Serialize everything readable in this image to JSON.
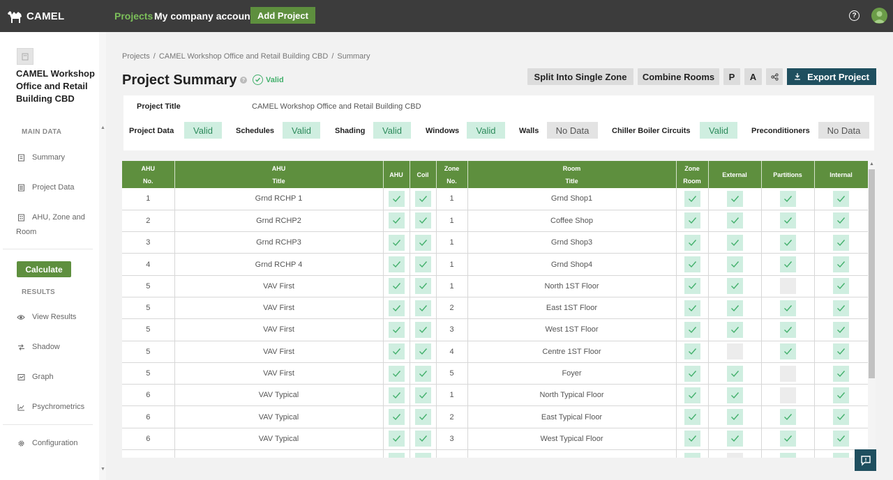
{
  "app": {
    "logo": "CAMEL"
  },
  "topnav": {
    "projects": "Projects",
    "company": "My company accounts",
    "add_project": "Add Project"
  },
  "sidebar": {
    "project_name": "CAMEL Workshop Office and Retail Building CBD",
    "main_data_label": "MAIN DATA",
    "items": [
      {
        "label": "Summary",
        "icon": "document-icon"
      },
      {
        "label": "Project Data",
        "icon": "list-icon"
      },
      {
        "label": "AHU, Zone and Room",
        "icon": "building-icon"
      }
    ],
    "calculate": "Calculate",
    "results_label": "RESULTS",
    "result_items": [
      {
        "label": "View Results",
        "icon": "eye-icon"
      },
      {
        "label": "Shadow",
        "icon": "shadow-icon"
      },
      {
        "label": "Graph",
        "icon": "graph-icon"
      },
      {
        "label": "Psychrometrics",
        "icon": "chart-icon"
      }
    ],
    "configuration": "Configuration"
  },
  "breadcrumb": [
    "Projects",
    "CAMEL Workshop Office and Retail Building CBD",
    "Summary"
  ],
  "page": {
    "title": "Project Summary",
    "status": "Valid"
  },
  "toolbar": {
    "split": "Split Into Single Zone",
    "combine": "Combine Rooms",
    "p": "P",
    "a": "A",
    "export": "Export Project"
  },
  "project_title": {
    "label": "Project Title",
    "value": "CAMEL Workshop Office and Retail Building CBD"
  },
  "statuses": [
    {
      "label": "Project Data",
      "value": "Valid"
    },
    {
      "label": "Schedules",
      "value": "Valid"
    },
    {
      "label": "Shading",
      "value": "Valid"
    },
    {
      "label": "Windows",
      "value": "Valid"
    },
    {
      "label": "Walls",
      "value": "No Data"
    },
    {
      "label": "Chiller Boiler Circuits",
      "value": "Valid"
    },
    {
      "label": "Preconditioners",
      "value": "No Data"
    }
  ],
  "table": {
    "headers": [
      [
        "AHU",
        "No."
      ],
      [
        "AHU",
        "Title"
      ],
      [
        "AHU"
      ],
      [
        "Coil"
      ],
      [
        "Zone",
        "No."
      ],
      [
        "Room",
        "Title"
      ],
      [
        "Zone",
        "Room"
      ],
      [
        "External"
      ],
      [
        "Partitions"
      ],
      [
        "Internal"
      ]
    ],
    "rows": [
      {
        "ahu_no": "1",
        "ahu_title": "Grnd RCHP 1",
        "zone_no": "1",
        "room_title": "Grnd Shop1",
        "partitions": true
      },
      {
        "ahu_no": "2",
        "ahu_title": "Grnd RCHP2",
        "zone_no": "1",
        "room_title": "Coffee Shop",
        "partitions": true
      },
      {
        "ahu_no": "3",
        "ahu_title": "Grnd RCHP3",
        "zone_no": "1",
        "room_title": "Grnd Shop3",
        "partitions": true
      },
      {
        "ahu_no": "4",
        "ahu_title": "Grnd RCHP 4",
        "zone_no": "1",
        "room_title": "Grnd Shop4",
        "partitions": true
      },
      {
        "ahu_no": "5",
        "ahu_title": "VAV First",
        "zone_no": "1",
        "room_title": "North 1ST Floor",
        "partitions": false
      },
      {
        "ahu_no": "5",
        "ahu_title": "VAV First",
        "zone_no": "2",
        "room_title": "East 1ST Floor",
        "partitions": true
      },
      {
        "ahu_no": "5",
        "ahu_title": "VAV First",
        "zone_no": "3",
        "room_title": "West 1ST Floor",
        "partitions": true
      },
      {
        "ahu_no": "5",
        "ahu_title": "VAV First",
        "zone_no": "4",
        "room_title": "Centre 1ST Floor",
        "external": false,
        "partitions": true
      },
      {
        "ahu_no": "5",
        "ahu_title": "VAV First",
        "zone_no": "5",
        "room_title": "Foyer",
        "partitions": false
      },
      {
        "ahu_no": "6",
        "ahu_title": "VAV Typical",
        "zone_no": "1",
        "room_title": "North Typical Floor",
        "partitions": false
      },
      {
        "ahu_no": "6",
        "ahu_title": "VAV Typical",
        "zone_no": "2",
        "room_title": "East Typical Floor",
        "partitions": true
      },
      {
        "ahu_no": "6",
        "ahu_title": "VAV Typical",
        "zone_no": "3",
        "room_title": "West Typical Floor",
        "partitions": true
      },
      {
        "ahu_no": "",
        "ahu_title": "",
        "zone_no": "",
        "room_title": "",
        "external": false,
        "partitions": true
      }
    ]
  },
  "colors": {
    "topbar": "#3c3c3c",
    "accent_green": "#5e8f3e",
    "valid_bg": "#cfeee0",
    "valid_text": "#2c8a5b",
    "export": "#1f4f5f"
  }
}
